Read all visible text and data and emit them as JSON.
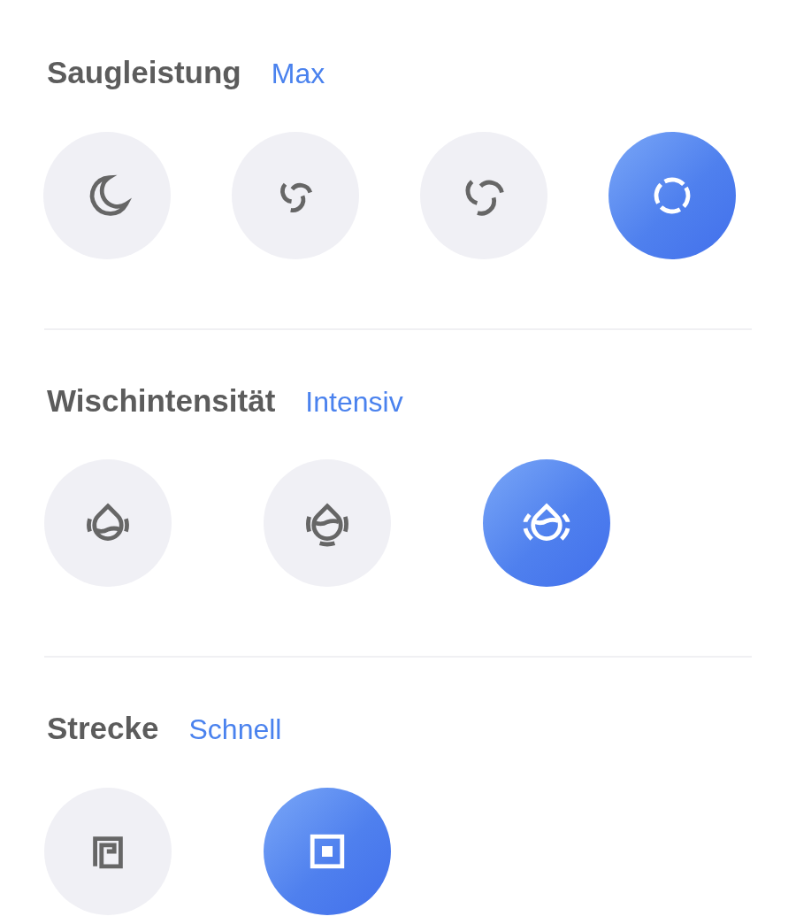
{
  "sections": [
    {
      "title": "Saugleistung",
      "value": "Max",
      "options": [
        {
          "kind": "moon",
          "selected": false
        },
        {
          "kind": "fan-small",
          "selected": false
        },
        {
          "kind": "fan",
          "selected": false
        },
        {
          "kind": "fan-ring",
          "selected": true
        }
      ]
    },
    {
      "title": "Wischintensität",
      "value": "Intensiv",
      "options": [
        {
          "kind": "drop-low",
          "selected": false
        },
        {
          "kind": "drop-mid",
          "selected": false
        },
        {
          "kind": "drop-high",
          "selected": true
        }
      ]
    },
    {
      "title": "Strecke",
      "value": "Schnell",
      "options": [
        {
          "kind": "maze",
          "selected": false
        },
        {
          "kind": "square",
          "selected": true
        }
      ]
    }
  ]
}
